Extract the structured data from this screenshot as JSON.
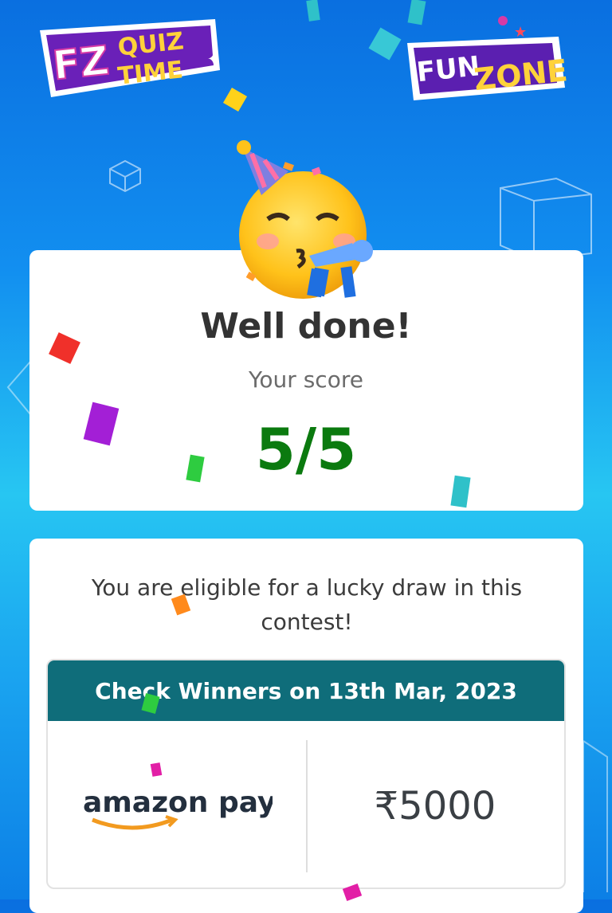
{
  "header": {
    "left_logo_text": [
      "FZ",
      "QUIZ",
      "TIME"
    ],
    "right_logo_text": [
      "FUN",
      "ZONE"
    ]
  },
  "result": {
    "title": "Well done!",
    "score_label": "Your score",
    "score_value": "5/5",
    "emoji": "partying-face-icon"
  },
  "draw": {
    "message": "You are eligible for a lucky draw in this contest!",
    "winners_header": "Check Winners on 13th Mar, 2023",
    "prize_brand": "amazon pay",
    "prize_amount": "₹5000"
  },
  "colors": {
    "score_green": "#0b7a0f",
    "header_teal": "#0f6d7a",
    "background_blue": "#128ff0",
    "amazon_orange": "#f29a1f"
  }
}
